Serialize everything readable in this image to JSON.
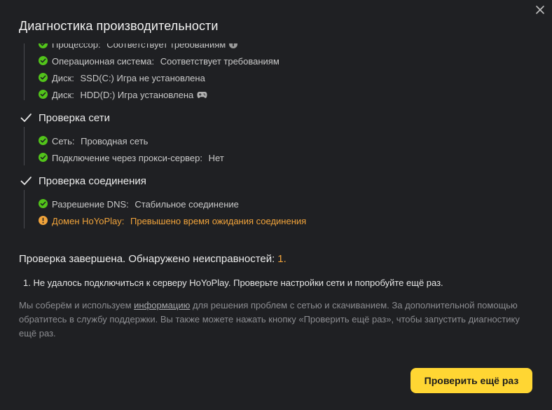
{
  "dialog": {
    "title": "Диагностика производительности",
    "close_icon": "close-icon"
  },
  "system_items": [
    {
      "label": "Процессор:",
      "value": "Соответствует требованиям",
      "status": "ok",
      "tail_icon": "info-icon"
    },
    {
      "label": "Операционная система:",
      "value": "Соответствует требованиям",
      "status": "ok"
    },
    {
      "label": "Диск:",
      "value": "SSD(C:) Игра не установлена",
      "status": "ok"
    },
    {
      "label": "Диск:",
      "value": "HDD(D:) Игра установлена",
      "status": "ok",
      "tail_icon": "gamepad-icon"
    }
  ],
  "network_section": {
    "title": "Проверка сети",
    "items": [
      {
        "label": "Сеть:",
        "value": "Проводная сеть",
        "status": "ok"
      },
      {
        "label": "Подключение через прокси-сервер:",
        "value": "Нет",
        "status": "ok"
      }
    ]
  },
  "connection_section": {
    "title": "Проверка соединения",
    "items": [
      {
        "label": "Разрешение DNS:",
        "value": "Стабильное соединение",
        "status": "ok"
      },
      {
        "label": "Домен HoYoPlay:",
        "value": "Превышено время ожидания соединения",
        "status": "warning"
      }
    ]
  },
  "summary": {
    "text": "Проверка завершена. Обнаружено неисправностей:",
    "count": "1."
  },
  "issues": [
    "1. Не удалось подключиться к серверу HoYoPlay. Проверьте настройки сети и попробуйте ещё раз."
  ],
  "note": {
    "before": "Мы соберём и используем ",
    "link": "информацию",
    "after": " для решения проблем с сетью и скачиванием. За дополнительной помощью обратитесь в службу поддержки. Вы также можете нажать кнопку «Проверить ещё раз», чтобы запустить диагностику ещё раз."
  },
  "retry_button": "Проверить ещё раз",
  "colors": {
    "background": "#1f2023",
    "ok": "#52c41a",
    "warning": "#f0a33b",
    "button": "#ffd633"
  }
}
